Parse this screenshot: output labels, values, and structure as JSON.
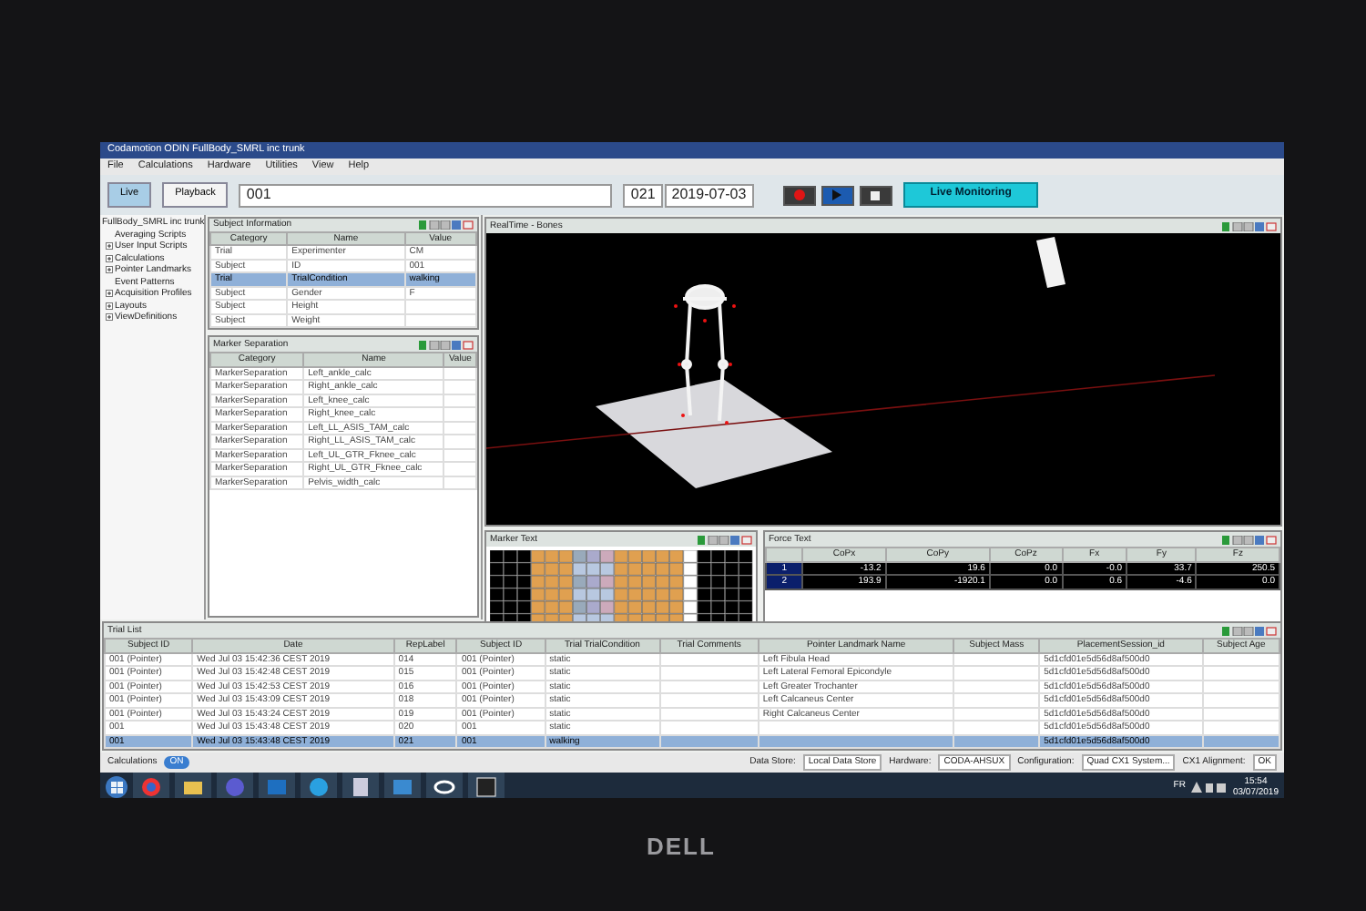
{
  "window": {
    "title": "Codamotion ODIN FullBody_SMRL inc trunk"
  },
  "menu": [
    "File",
    "Calculations",
    "Hardware",
    "Utilities",
    "View",
    "Help"
  ],
  "toolbar": {
    "modes": [
      {
        "label": "Live",
        "selected": true
      },
      {
        "label": "Playback",
        "selected": false
      }
    ],
    "subject_id": "001",
    "trial_number": "021",
    "date": "2019-07-03",
    "monitor_button": "Live Monitoring"
  },
  "tree": {
    "label": "FullBody_SMRL inc trunk",
    "children": [
      {
        "label": "Averaging Scripts",
        "kind": "leaf"
      },
      {
        "label": "User Input Scripts",
        "kind": "folder"
      },
      {
        "label": "Calculations",
        "kind": "folder"
      },
      {
        "label": "Pointer Landmarks",
        "kind": "folder"
      },
      {
        "label": "Event Patterns",
        "kind": "leaf"
      },
      {
        "label": "Acquisition Profiles",
        "kind": "folder"
      },
      {
        "label": "Layouts",
        "kind": "folder"
      },
      {
        "label": "ViewDefinitions",
        "kind": "folder"
      }
    ]
  },
  "subject_information": {
    "title": "Subject Information",
    "columns": [
      "Category",
      "Name",
      "Value"
    ],
    "rows": [
      {
        "cells": [
          "Trial",
          "Experimenter",
          "CM"
        ],
        "selected": false
      },
      {
        "cells": [
          "Subject",
          "ID",
          "001"
        ],
        "selected": false
      },
      {
        "cells": [
          "Trial",
          "TrialCondition",
          "walking"
        ],
        "selected": true
      },
      {
        "cells": [
          "Subject",
          "Gender",
          "F"
        ],
        "selected": false
      },
      {
        "cells": [
          "Subject",
          "Height",
          ""
        ],
        "selected": false
      },
      {
        "cells": [
          "Subject",
          "Weight",
          ""
        ],
        "selected": false
      }
    ]
  },
  "marker_separation": {
    "title": "Marker Separation",
    "columns": [
      "Category",
      "Name",
      "Value"
    ],
    "rows": [
      [
        "MarkerSeparation",
        "Left_ankle_calc",
        ""
      ],
      [
        "MarkerSeparation",
        "Right_ankle_calc",
        ""
      ],
      [
        "MarkerSeparation",
        "Left_knee_calc",
        ""
      ],
      [
        "MarkerSeparation",
        "Right_knee_calc",
        ""
      ],
      [
        "MarkerSeparation",
        "Left_LL_ASIS_TAM_calc",
        ""
      ],
      [
        "MarkerSeparation",
        "Right_LL_ASIS_TAM_calc",
        ""
      ],
      [
        "MarkerSeparation",
        "Left_UL_GTR_Fknee_calc",
        ""
      ],
      [
        "MarkerSeparation",
        "Right_UL_GTR_Fknee_calc",
        ""
      ],
      [
        "MarkerSeparation",
        "Pelvis_width_calc",
        ""
      ]
    ]
  },
  "realtime": {
    "title": "RealTime - Bones"
  },
  "marker_text": {
    "title": "Marker Text"
  },
  "force_text": {
    "title": "Force Text",
    "columns": [
      "CoPx",
      "CoPy",
      "CoPz",
      "Fx",
      "Fy",
      "Fz"
    ],
    "rows": [
      {
        "label": "1",
        "cells": [
          "-13.2",
          "19.6",
          "0.0",
          "-0.0",
          "33.7",
          "250.5"
        ]
      },
      {
        "label": "2",
        "cells": [
          "193.9",
          "-1920.1",
          "0.0",
          "0.6",
          "-4.6",
          "0.0"
        ]
      }
    ]
  },
  "trial_list": {
    "title": "Trial List",
    "columns": [
      "Subject ID",
      "Date",
      "RepLabel",
      "Subject ID",
      "Trial TrialCondition",
      "Trial Comments",
      "Pointer Landmark Name",
      "Subject Mass",
      "PlacementSession_id",
      "Subject Age"
    ],
    "rows": [
      {
        "cells": [
          "001 (Pointer)",
          "Wed Jul 03 15:42:36 CEST 2019",
          "014",
          "001 (Pointer)",
          "static",
          "",
          "Left Fibula Head",
          "",
          "5d1cfd01e5d56d8af500d0",
          ""
        ],
        "selected": false
      },
      {
        "cells": [
          "001 (Pointer)",
          "Wed Jul 03 15:42:48 CEST 2019",
          "015",
          "001 (Pointer)",
          "static",
          "",
          "Left Lateral Femoral Epicondyle",
          "",
          "5d1cfd01e5d56d8af500d0",
          ""
        ],
        "selected": false
      },
      {
        "cells": [
          "001 (Pointer)",
          "Wed Jul 03 15:42:53 CEST 2019",
          "016",
          "001 (Pointer)",
          "static",
          "",
          "Left Greater Trochanter",
          "",
          "5d1cfd01e5d56d8af500d0",
          ""
        ],
        "selected": false
      },
      {
        "cells": [
          "001 (Pointer)",
          "Wed Jul 03 15:43:09 CEST 2019",
          "018",
          "001 (Pointer)",
          "static",
          "",
          "Left Calcaneus Center",
          "",
          "5d1cfd01e5d56d8af500d0",
          ""
        ],
        "selected": false
      },
      {
        "cells": [
          "001 (Pointer)",
          "Wed Jul 03 15:43:24 CEST 2019",
          "019",
          "001 (Pointer)",
          "static",
          "",
          "Right Calcaneus Center",
          "",
          "5d1cfd01e5d56d8af500d0",
          ""
        ],
        "selected": false
      },
      {
        "cells": [
          "001",
          "Wed Jul 03 15:43:48 CEST 2019",
          "020",
          "001",
          "static",
          "",
          "",
          "",
          "5d1cfd01e5d56d8af500d0",
          ""
        ],
        "selected": false
      },
      {
        "cells": [
          "001",
          "Wed Jul 03 15:43:48 CEST 2019",
          "021",
          "001",
          "walking",
          "",
          "",
          "",
          "5d1cfd01e5d56d8af500d0",
          ""
        ],
        "selected": true
      }
    ]
  },
  "status_bar": {
    "calculations_label": "Calculations",
    "calculations_toggle": {
      "label": "ON",
      "on": true
    },
    "fields": [
      {
        "label": "Data Store:",
        "value": "Local Data Store"
      },
      {
        "label": "Hardware:",
        "value": "CODA-AHSUX"
      },
      {
        "label": "Configuration:",
        "value": "Quad CX1 System..."
      },
      {
        "label": "CX1 Alignment:",
        "value": "OK"
      }
    ]
  },
  "taskbar": {
    "language": "FR",
    "time": "15:54",
    "date": "03/07/2019"
  },
  "monitor": {
    "brand": "DELL"
  }
}
